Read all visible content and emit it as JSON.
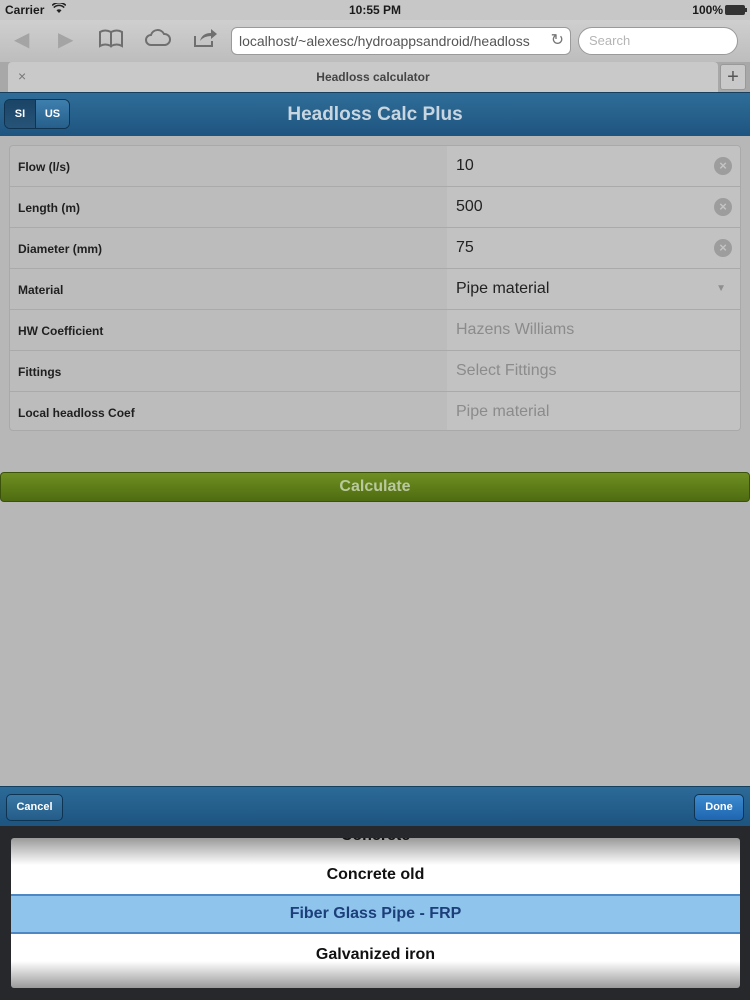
{
  "status": {
    "carrier": "Carrier",
    "time": "10:55 PM",
    "battery": "100%"
  },
  "browser": {
    "url": "localhost/~alexesc/hydroappsandroid/headloss",
    "search_placeholder": "Search",
    "tab_title": "Headloss calculator",
    "close_glyph": "×",
    "add_glyph": "+"
  },
  "app": {
    "title": "Headloss Calc Plus",
    "units": [
      "SI",
      "US"
    ],
    "active_unit": "SI"
  },
  "form": {
    "rows": [
      {
        "label": "Flow (l/s)",
        "value": "10"
      },
      {
        "label": "Length (m)",
        "value": "500"
      },
      {
        "label": "Diameter (mm)",
        "value": "75"
      },
      {
        "label": "Material",
        "value": "Pipe material"
      },
      {
        "label": "HW Coefficient",
        "placeholder": "Hazens Williams"
      },
      {
        "label": "Fittings",
        "placeholder": "Select Fittings"
      },
      {
        "label": "Local headloss Coef",
        "placeholder": "Pipe material"
      }
    ],
    "calculate_label": "Calculate"
  },
  "picker": {
    "cancel_label": "Cancel",
    "done_label": "Done",
    "options": [
      "Concrete",
      "Concrete old",
      "Fiber Glass Pipe - FRP",
      "Galvanized iron"
    ],
    "selected": "Fiber Glass Pipe - FRP"
  },
  "icons": {
    "wifi": "wifi-icon",
    "battery": "battery-icon",
    "back": "back-arrow-icon",
    "forward": "forward-arrow-icon",
    "bookmarks": "bookmarks-icon",
    "icloud": "cloud-icon",
    "share": "share-icon",
    "reload": "reload-icon",
    "clear": "clear-icon",
    "dropdown": "chevron-down-icon"
  },
  "colors": {
    "header": "#1e5580",
    "calculate": "#5a7a16",
    "picker_selected": "#8fc4ed"
  }
}
